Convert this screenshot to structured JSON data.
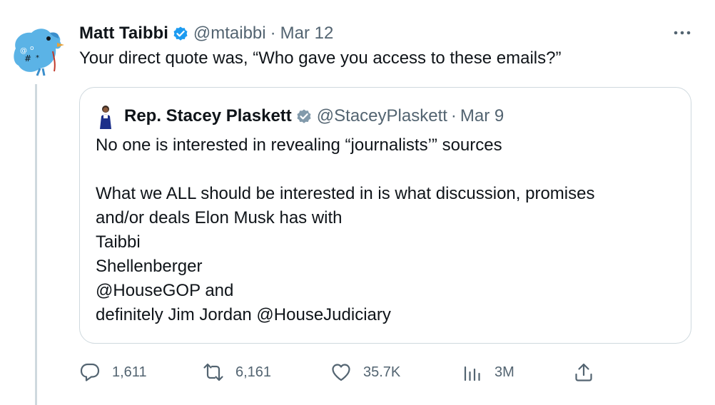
{
  "tweet": {
    "author_name": "Matt Taibbi",
    "author_handle": "@mtaibbi",
    "separator": "·",
    "date": "Mar 12",
    "text": "Your direct quote was, “Who gave you access to these emails?”",
    "more_label": "···"
  },
  "quoted_tweet": {
    "author_name": "Rep. Stacey Plaskett",
    "author_handle": "@StaceyPlaskett",
    "separator": "·",
    "date": "Mar 9",
    "lines": [
      "No one is interested in revealing “journalists’” sources",
      "",
      "What we ALL should be interested in is what discussion, promises",
      "and/or deals Elon Musk has with",
      "Taibbi",
      "Shellenberger",
      "@HouseGOP and",
      "definitely Jim Jordan  @HouseJudiciary"
    ]
  },
  "actions": {
    "reply_count": "1,611",
    "retweet_count": "6,161",
    "like_count": "35.7K",
    "views_count": "3M"
  },
  "icons": {
    "verified": "verified-badge-icon",
    "more": "more-icon",
    "reply": "reply-icon",
    "retweet": "retweet-icon",
    "like": "like-icon",
    "views": "views-icon",
    "share": "share-icon"
  },
  "colors": {
    "verified_blue": "#1d9bf0",
    "secondary_text": "#536471",
    "border": "#cfd9de"
  }
}
